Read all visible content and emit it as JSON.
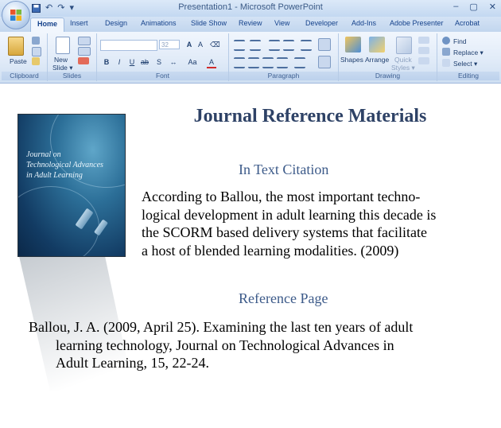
{
  "window": {
    "title": "Presentation1 - Microsoft PowerPoint",
    "qat": {
      "save_icon": "save-icon",
      "undo": "↶",
      "redo": "↷",
      "more": "▾"
    },
    "controls": {
      "minimize": "–",
      "restore": "▢",
      "close": "✕"
    }
  },
  "tabs": [
    "Home",
    "Insert",
    "Design",
    "Animations",
    "Slide Show",
    "Review",
    "View",
    "Developer",
    "Add-Ins",
    "Adobe Presenter",
    "Acrobat"
  ],
  "ribbon": {
    "clipboard": {
      "label": "Clipboard",
      "paste": "Paste"
    },
    "slides": {
      "label": "Slides",
      "new_slide": "New",
      "new_slide2": "Slide ▾"
    },
    "font": {
      "label": "Font",
      "size": "32"
    },
    "paragraph": {
      "label": "Paragraph"
    },
    "drawing": {
      "label": "Drawing",
      "shapes": "Shapes",
      "arrange": "Arrange",
      "quick": "Quick",
      "styles": "Styles ▾"
    },
    "editing": {
      "label": "Editing",
      "find": "Find",
      "replace": "Replace ▾",
      "select": "Select ▾"
    }
  },
  "slide": {
    "heading": "Journal Reference Materials",
    "cover_title": [
      "Journal on",
      "Technological Advances",
      "in Adult Learning"
    ],
    "in_text_heading": "In Text Citation",
    "in_text_lines": [
      "According to Ballou, the most important techno-",
      "logical development in adult learning this decade is",
      "the SCORM based delivery systems that facilitate",
      "a host of blended learning modalities. (2009)"
    ],
    "reference_heading": "Reference Page",
    "reference_lines": [
      "Ballou, J. A. (2009, April 25). Examining the last ten years of adult",
      "learning technology, Journal on Technological Advances in",
      "Adult Learning, 15, 22-24."
    ]
  }
}
